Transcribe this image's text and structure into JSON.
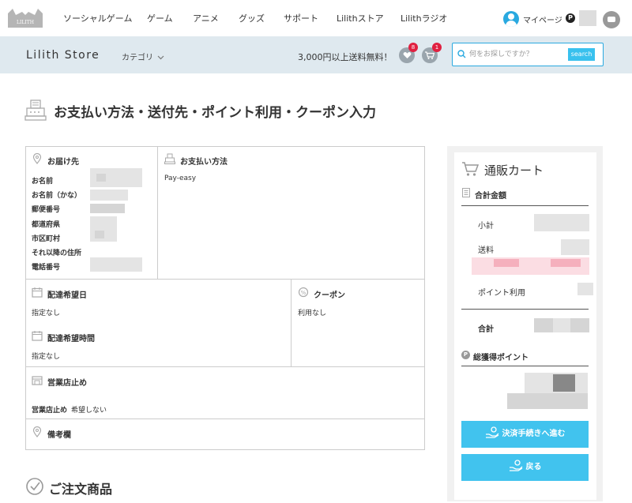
{
  "nav": {
    "logo_text": "LILITH",
    "items": [
      "ソーシャルゲーム",
      "ゲーム",
      "アニメ",
      "グッズ",
      "サポート",
      "Lilithストア",
      "Lilithラジオ"
    ],
    "mypage": "マイページ",
    "points_badge": "P"
  },
  "store": {
    "title": "Lilith Store",
    "category": "カテゴリ",
    "shipping": "3,000円以上送料無料！",
    "wishlist_count": "8",
    "cart_count": "1",
    "search_placeholder": "何をお探しですか？",
    "search_button": "search"
  },
  "page": {
    "title": "お支払い方法・送付先・ポイント利用・クーポン入力"
  },
  "delivery": {
    "title": "お届け先",
    "fields": [
      "お名前",
      "お名前（かな）",
      "郵便番号",
      "都道府県",
      "市区町村",
      "それ以降の住所",
      "電話番号"
    ]
  },
  "payment": {
    "title": "お支払い方法",
    "value": "Pay-easy"
  },
  "delivery_date": {
    "title": "配達希望日",
    "value": "指定なし"
  },
  "delivery_time": {
    "title": "配達希望時間",
    "value": "指定なし"
  },
  "coupon": {
    "title": "クーポン",
    "value": "利用なし"
  },
  "store_pickup": {
    "title": "営業店止め",
    "label": "営業店止め",
    "value": "希望しない"
  },
  "remarks": {
    "title": "備考欄"
  },
  "cart": {
    "title": "通販カート",
    "total_title": "合計金額",
    "subtotal": "小計",
    "shipping": "送料",
    "points_use": "ポイント利用",
    "total": "合計",
    "earned_points": "総獲得ポイント",
    "checkout_button": "決済手続きへ進む",
    "back_button": "戻る"
  },
  "order": {
    "title": "ご注文商品"
  },
  "colors": {
    "accent": "#41c3ee",
    "store_bar": "#dfe9ef",
    "badge": "#e02040"
  }
}
